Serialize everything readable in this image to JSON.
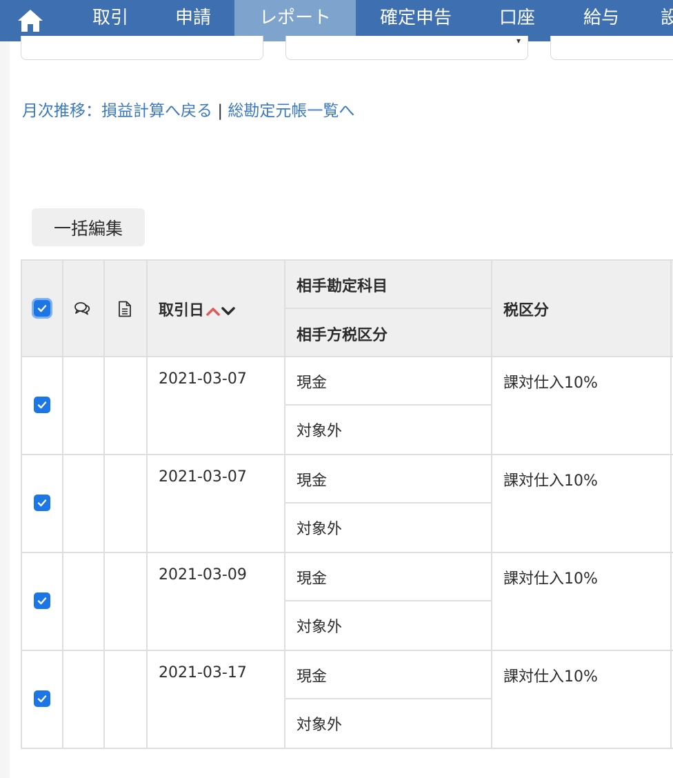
{
  "nav": {
    "items": [
      {
        "label": "取引"
      },
      {
        "label": "申請"
      },
      {
        "label": "レポート",
        "active": true
      },
      {
        "label": "確定申告"
      },
      {
        "label": "口座"
      },
      {
        "label": "給与"
      },
      {
        "label": "設"
      }
    ],
    "home_icon": "home-icon",
    "bg_color": "#3e6fb0",
    "active_color": "#7ea3cc"
  },
  "links": {
    "monthly_label": "月次推移：",
    "back_to_pl": "損益計算へ戻る",
    "separator": "|",
    "general_ledger": "総勘定元帳一覧へ"
  },
  "toolbar": {
    "bulk_edit_label": "一括編集"
  },
  "table": {
    "headers": {
      "date": "取引日",
      "counter_account": "相手勘定科目",
      "counter_tax": "相手方税区分",
      "tax_category": "税区分"
    },
    "header_icons": [
      "comment-icon",
      "document-icon"
    ],
    "sort_icons": [
      "sort-up-icon",
      "sort-down-icon"
    ],
    "select_all_checked": true,
    "rows": [
      {
        "checked": true,
        "date": "2021-03-07",
        "account": "現金",
        "counter_tax": "対象外",
        "tax": "課対仕入10%"
      },
      {
        "checked": true,
        "date": "2021-03-07",
        "account": "現金",
        "counter_tax": "対象外",
        "tax": "課対仕入10%"
      },
      {
        "checked": true,
        "date": "2021-03-09",
        "account": "現金",
        "counter_tax": "対象外",
        "tax": "課対仕入10%"
      },
      {
        "checked": true,
        "date": "2021-03-17",
        "account": "現金",
        "counter_tax": "対象外",
        "tax": "課対仕入10%"
      }
    ]
  },
  "colors": {
    "link": "#3a78c2",
    "checkbox": "#1d76e6",
    "sort_up": "#e05a5a"
  }
}
